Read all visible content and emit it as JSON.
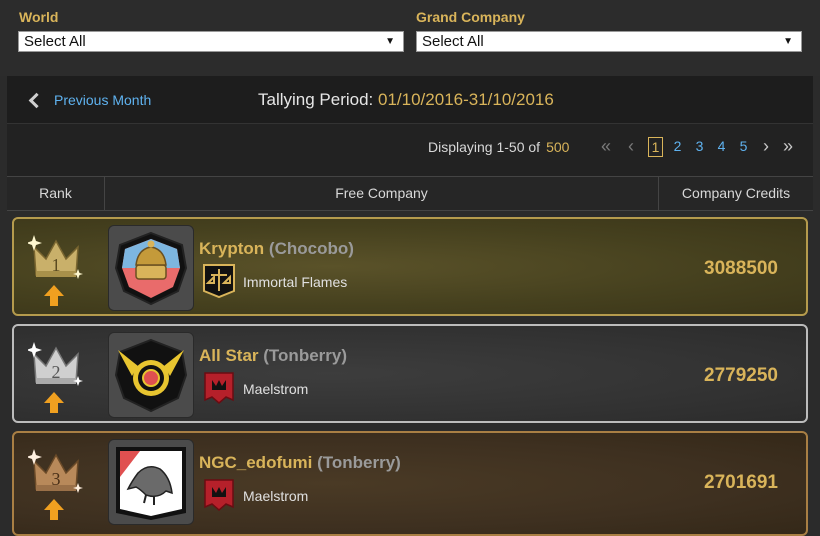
{
  "filters": {
    "world": {
      "label": "World",
      "selected": "Select All"
    },
    "grand_company": {
      "label": "Grand Company",
      "selected": "Select All"
    }
  },
  "period": {
    "prev_label": "Previous Month",
    "label": "Tallying Period:",
    "range": "01/10/2016-31/10/2016"
  },
  "pager": {
    "displaying": "Displaying 1-50 of",
    "total": "500",
    "pages": [
      "1",
      "2",
      "3",
      "4",
      "5"
    ],
    "current": "1"
  },
  "table": {
    "headers": {
      "rank": "Rank",
      "free_company": "Free Company",
      "credits": "Company Credits"
    }
  },
  "rows": [
    {
      "rank": "1",
      "name": "Krypton",
      "world": "(Chocobo)",
      "grand_company": "Immortal Flames",
      "credits": "3088500"
    },
    {
      "rank": "2",
      "name": "All Star",
      "world": "(Tonberry)",
      "grand_company": "Maelstrom",
      "credits": "2779250"
    },
    {
      "rank": "3",
      "name": "NGC_edofumi",
      "world": "(Tonberry)",
      "grand_company": "Maelstrom",
      "credits": "2701691"
    }
  ],
  "colors": {
    "accent_gold": "#d9b45a",
    "link_blue": "#5fb2ef"
  }
}
